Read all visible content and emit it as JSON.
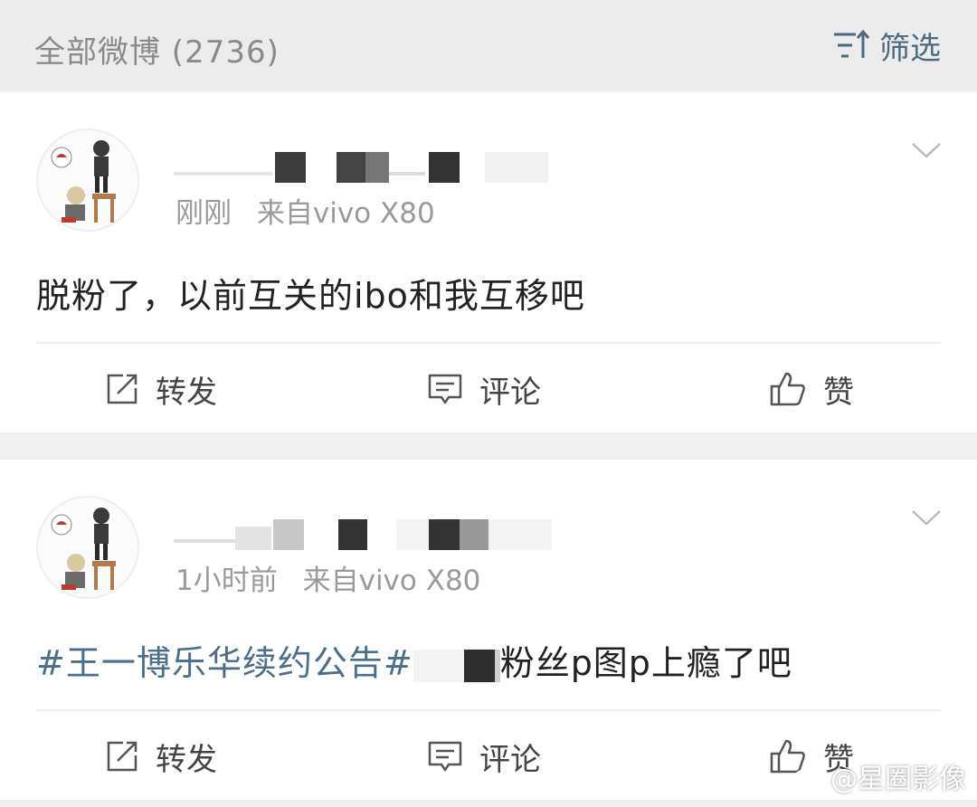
{
  "header": {
    "title": "全部微博 (2736)",
    "filter_label": "筛选"
  },
  "posts": [
    {
      "time": "刚刚",
      "source": "来自vivo X80",
      "text": "脱粉了，以前互关的ibo和我互移吧",
      "actions": {
        "repost": "转发",
        "comment": "评论",
        "like": "赞"
      }
    },
    {
      "time": "1小时前",
      "source": "来自vivo X80",
      "hashtag": "#王一博乐华续约公告#",
      "text": "粉丝p图p上瘾了吧",
      "actions": {
        "repost": "转发",
        "comment": "评论",
        "like": "赞"
      }
    }
  ],
  "watermark": {
    "text": "@星圈影像"
  },
  "colors": {
    "link": "#4b6e8c",
    "meta": "#9a9a9a",
    "background": "#efefef"
  }
}
